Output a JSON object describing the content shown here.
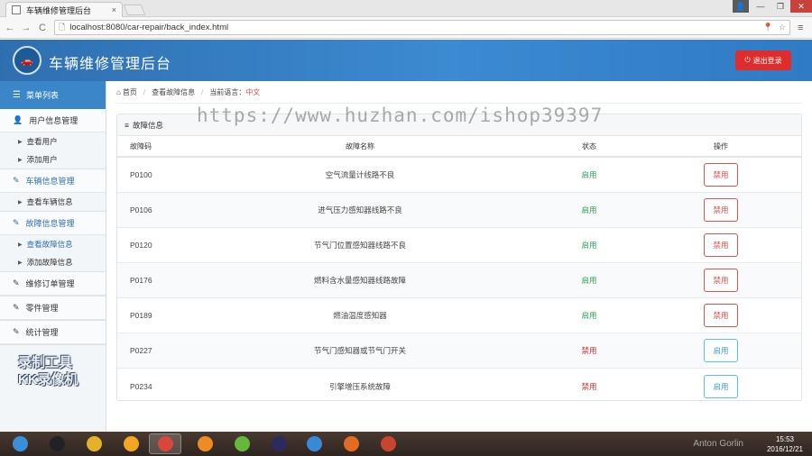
{
  "browser": {
    "tab_title": "车辆维修管理后台",
    "tab_close": "×",
    "url": "localhost:8080/car-repair/back_index.html",
    "back": "←",
    "forward": "→",
    "reload": "C",
    "menu": "≡",
    "omni_icons": [
      "📍",
      "☆"
    ]
  },
  "window": {
    "min": "—",
    "max": "❐",
    "close": "✕",
    "user": "👤"
  },
  "header": {
    "title": "车辆维修管理后台",
    "logo_glyph": "🚗",
    "logout_label": "退出登录",
    "logout_icon": "⏻"
  },
  "sidebar": {
    "head": "菜单列表",
    "groups": [
      {
        "title": "用户信息管理",
        "icon": "👤",
        "items": [
          "查看用户",
          "添加用户"
        ]
      },
      {
        "title": "车辆信息管理",
        "icon": "✎",
        "items": [
          "查看车辆信息"
        ]
      },
      {
        "title": "故障信息管理",
        "icon": "✎",
        "items": [
          "查看故障信息",
          "添加故障信息"
        ]
      },
      {
        "title": "维修订单管理",
        "icon": "✎",
        "items": []
      },
      {
        "title": "零件管理",
        "icon": "✎",
        "items": []
      },
      {
        "title": "统计管理",
        "icon": "✎",
        "items": []
      }
    ]
  },
  "breadcrumb": {
    "home": "首页",
    "home_icon": "⌂",
    "page": "查看故障信息",
    "lang_label": "当前语言：",
    "lang_value": "中文"
  },
  "panel": {
    "title": "故障信息",
    "title_icon": "≡",
    "columns": [
      "故障码",
      "故障名称",
      "状态",
      "操作"
    ],
    "rows": [
      {
        "code": "P0100",
        "name": "空气流量计线路不良",
        "status": "启用",
        "action": "禁用",
        "enabled": true
      },
      {
        "code": "P0106",
        "name": "进气压力感知器线路不良",
        "status": "启用",
        "action": "禁用",
        "enabled": true
      },
      {
        "code": "P0120",
        "name": "节气门位置感知器线路不良",
        "status": "启用",
        "action": "禁用",
        "enabled": true
      },
      {
        "code": "P0176",
        "name": "燃料含水量感知器线路故障",
        "status": "启用",
        "action": "禁用",
        "enabled": true
      },
      {
        "code": "P0189",
        "name": "燃油温度感知器",
        "status": "启用",
        "action": "禁用",
        "enabled": true
      },
      {
        "code": "P0227",
        "name": "节气门感知器或节气门开关",
        "status": "禁用",
        "action": "启用",
        "enabled": false
      },
      {
        "code": "P0234",
        "name": "引擎增压系统故障",
        "status": "禁用",
        "action": "启用",
        "enabled": false
      }
    ]
  },
  "overlay": {
    "watermark": "https://www.huzhan.com/ishop39397",
    "rec_line1": "录制工具",
    "rec_line2": "KK录像机"
  },
  "taskbar": {
    "apps": [
      {
        "name": "start-orb",
        "color": "#3a8fd8"
      },
      {
        "name": "qq-app",
        "color": "#222222"
      },
      {
        "name": "ie-app",
        "color": "#e3b227"
      },
      {
        "name": "fish-app",
        "color": "#f2a623"
      },
      {
        "name": "chrome-app",
        "color": "#d8473a"
      },
      {
        "name": "wifi-app",
        "color": "#f08a24"
      },
      {
        "name": "360-app",
        "color": "#64b83c"
      },
      {
        "name": "eclipse-app",
        "color": "#2c2b5e"
      },
      {
        "name": "edge-app",
        "color": "#3a89d6"
      },
      {
        "name": "sublime-app",
        "color": "#e46b24"
      },
      {
        "name": "rec-app",
        "color": "#c8452f"
      }
    ],
    "user": "Anton Gorlin",
    "time": "15:53",
    "date": "2016/12/21"
  }
}
